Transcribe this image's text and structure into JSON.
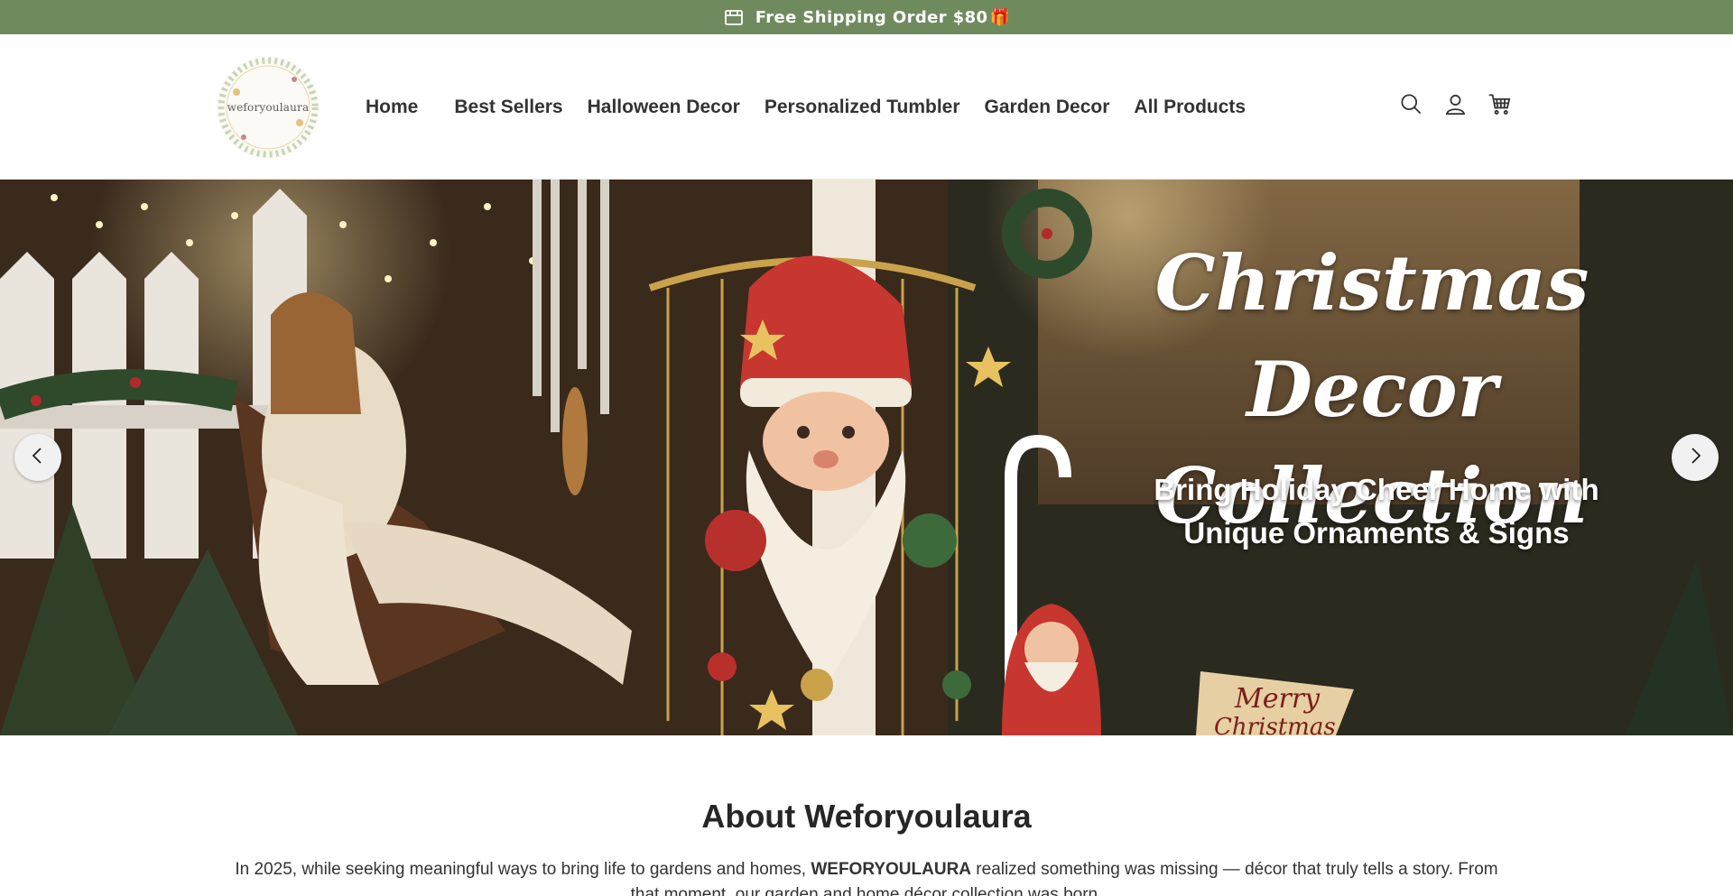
{
  "announcement": {
    "text": "Free Shipping Order $80",
    "emoji": "🎁",
    "icon": "gift-box-icon"
  },
  "header": {
    "logo_text": "weforyoulaura",
    "nav": [
      "Home",
      "Best Sellers",
      "Halloween Decor",
      "Personalized Tumbler",
      "Garden Decor",
      "All Products"
    ],
    "icons": [
      "search-icon",
      "account-icon",
      "cart-icon"
    ]
  },
  "hero": {
    "title_line1": "Christmas",
    "title_line2": "Decor Collection",
    "subtitle_line1": "Bring Holiday Cheer Home with",
    "subtitle_line2": "Unique Ornaments & Signs",
    "sign_text_line1": "Merry",
    "sign_text_line2": "Christmas",
    "prev_icon": "chevron-left-icon",
    "next_icon": "chevron-right-icon"
  },
  "about": {
    "title": "About Weforyoulaura",
    "body_prefix": "In 2025, while seeking meaningful ways to bring life to gardens and homes, ",
    "body_brand": "WEFORYOULAURA",
    "body_suffix": " realized something was missing — décor that truly tells a story. From that moment, our garden and home décor collection was born."
  },
  "colors": {
    "announcement_bg": "#6f8b5e",
    "text_dark": "#333333"
  }
}
